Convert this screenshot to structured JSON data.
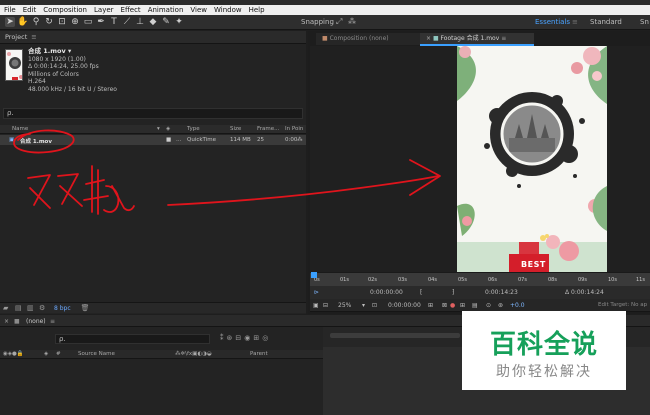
{
  "menubar": {
    "items": [
      "File",
      "Edit",
      "Composition",
      "Layer",
      "Effect",
      "Animation",
      "View",
      "Window",
      "Help"
    ]
  },
  "toolbar": {
    "tools": [
      "selection-tool-icon",
      "hand-tool-icon",
      "zoom-tool-icon",
      "rotate-tool-icon",
      "camera-tool-icon",
      "pan-behind-tool-icon",
      "rectangle-tool-icon",
      "pen-tool-icon",
      "type-tool-icon",
      "brush-tool-icon",
      "clone-stamp-tool-icon",
      "eraser-tool-icon",
      "roto-brush-tool-icon",
      "puppet-pin-tool-icon"
    ],
    "snapping_label": "Snapping",
    "workspaces": {
      "active": "Essentials",
      "second": "Standard",
      "third": "Sn"
    }
  },
  "project": {
    "title": "Project",
    "file": {
      "name": "合成 1.mov ▾",
      "meta": [
        "1080 x 1920 (1.00)",
        "Δ 0:00:14:24, 25.00 fps",
        "Millions of Colors",
        "H.264",
        "48.000 kHz / 16 bit U / Stereo"
      ]
    },
    "search_placeholder": "ρ.",
    "columns": {
      "name": "Name",
      "type": "Type",
      "size": "Size",
      "frame": "Frame...",
      "in_point": "In Poin"
    },
    "row": {
      "name": "合成 1.mov",
      "type": "QuickTime",
      "size": "114 MB",
      "frame": "25",
      "in_point": "0:00"
    },
    "footer_bpc": "8 bpc"
  },
  "viewer": {
    "tab_composition": "Composition (none)",
    "tab_footage": "Footage 合成 1.mov",
    "close_glyph": "×",
    "menu_glyph": "≡",
    "poster_text": "BEST",
    "ruler_ticks": [
      "0s",
      "01s",
      "02s",
      "03s",
      "04s",
      "05s",
      "06s",
      "07s",
      "08s",
      "09s",
      "10s",
      "11s"
    ],
    "zoom": "25%",
    "time_current": "0:00:00:00",
    "time_out": "0:00:14:23",
    "time_duration": "Δ 0:00:14:24",
    "time_start": "0:00:00:00",
    "edit_target": "Edit Target: No ap",
    "offset": "+0.0"
  },
  "timeline": {
    "tab_label": "(none)",
    "search_placeholder": "ρ.",
    "col_source": "Source Name",
    "col_parent": "Parent"
  },
  "annotation": {
    "handwriting": "双击"
  },
  "watermark": {
    "main": "百科全说",
    "sub": "助你轻松解决"
  },
  "colors": {
    "accent_blue": "#3aa0ff",
    "annotation_red": "#e0141c",
    "watermark_green": "#16a05a"
  }
}
